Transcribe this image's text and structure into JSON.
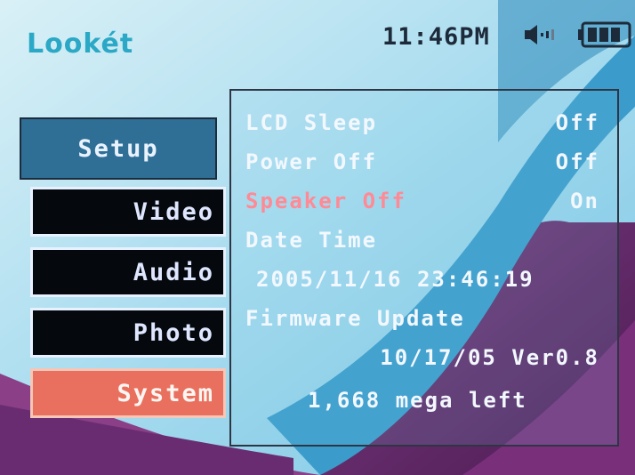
{
  "status": {
    "brand": "Lookét",
    "time": "11:46PM"
  },
  "menu": {
    "setup": "Setup",
    "items": [
      {
        "label": "Video",
        "selected": false
      },
      {
        "label": "Audio",
        "selected": false
      },
      {
        "label": "Photo",
        "selected": false
      },
      {
        "label": "System",
        "selected": true
      }
    ]
  },
  "settings": {
    "lcd_sleep": {
      "label": "LCD Sleep",
      "value": "Off"
    },
    "power_off": {
      "label": "Power Off",
      "value": "Off"
    },
    "speaker_off": {
      "label": "Speaker Off",
      "value": "On"
    },
    "date_time": {
      "label": "Date Time",
      "value": "2005/11/16 23:46:19"
    },
    "firmware": {
      "label": "Firmware Update",
      "value": "10/17/05 Ver0.8"
    },
    "storage": "1,668 mega left"
  },
  "colors": {
    "selected_menu": "#e9705e",
    "disabled_option": "#ff8a95",
    "brand": "#2aa8c6",
    "wave_purple": "#6a2c70"
  },
  "icons": [
    "speaker-icon",
    "battery-icon"
  ]
}
